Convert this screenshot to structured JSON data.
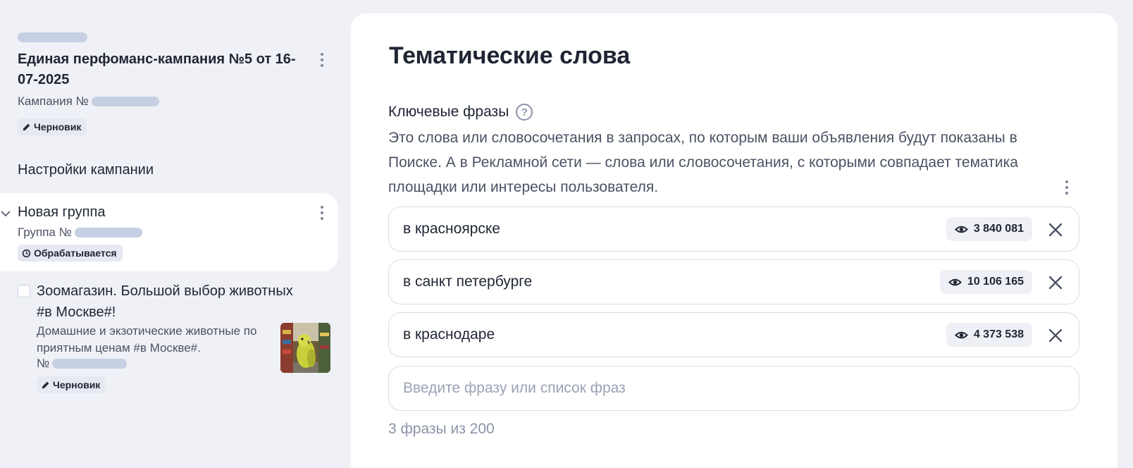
{
  "colors": {
    "background": "#eff1f6",
    "panel": "#ffffff",
    "text": "#1f2533",
    "muted": "#4a5263",
    "placeholder": "#9aa2b4",
    "badge": "#e6e9f1"
  },
  "sidebar": {
    "campaign": {
      "title": "Единая перфоманс-кампания №5 от 16-07-2025",
      "number_label": "Кампания №",
      "status": "Черновик",
      "status_icon": "pencil-icon"
    },
    "section_label": "Настройки кампании",
    "group": {
      "title": "Новая группа",
      "number_label": "Группа №",
      "status": "Обрабатывается",
      "status_icon": "clock-icon"
    },
    "ad": {
      "title": "Зоомагазин. Большой выбор животных #в Москве#!",
      "description": "Домашние и экзотические животные по приятным ценам #в Москве#.",
      "number_label": "№",
      "status": "Черновик",
      "status_icon": "pencil-icon"
    }
  },
  "main": {
    "title": "Тематические слова",
    "keywords_label": "Ключевые фразы",
    "help_icon": "question-icon",
    "description": "Это слова или словосочетания в запросах, по которым ваши объявления будут показаны в Поиске. А в Рекламной сети — слова или словосочетания, с которыми совпадает тематика площадки или интересы пользователя.",
    "phrases": [
      {
        "text": "в красноярске",
        "impressions": "3 840 081"
      },
      {
        "text": "в санкт петербурге",
        "impressions": "10 106 165"
      },
      {
        "text": "в краснодаре",
        "impressions": "4 373 538"
      }
    ],
    "input": {
      "placeholder": "Введите фразу или список фраз",
      "value": ""
    },
    "counter": "3 фразы из 200"
  }
}
